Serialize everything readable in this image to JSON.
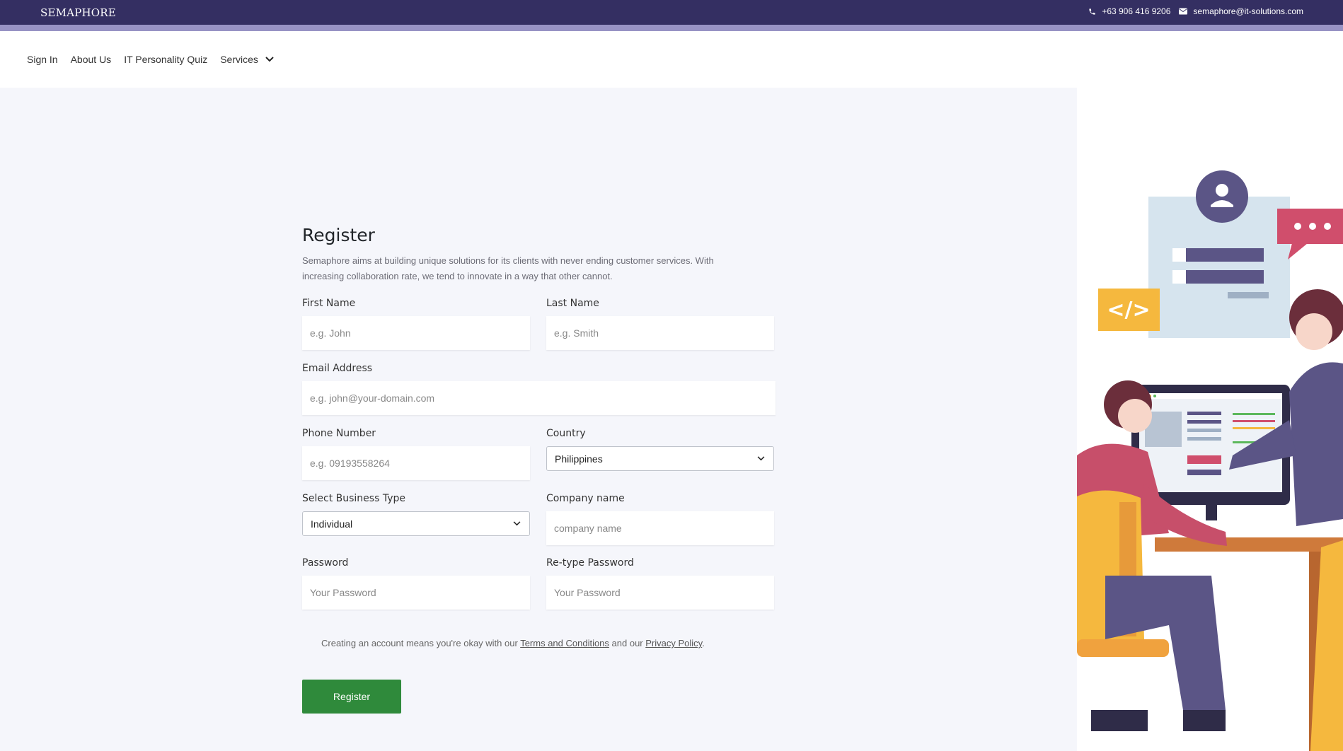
{
  "topbar": {
    "brand": "SEMAPHORE",
    "phone": "+63 906 416 9206",
    "email": "semaphore@it-solutions.com"
  },
  "nav": {
    "sign_in": "Sign In",
    "about_us": "About Us",
    "quiz": "IT Personality Quiz",
    "services": "Services"
  },
  "form": {
    "title": "Register",
    "description": "Semaphore aims at building unique solutions for its clients with never ending customer services. With increasing collaboration rate, we tend to innovate in a way that other cannot.",
    "first_name": {
      "label": "First Name",
      "placeholder": "e.g. John",
      "value": ""
    },
    "last_name": {
      "label": "Last Name",
      "placeholder": "e.g. Smith",
      "value": ""
    },
    "email": {
      "label": "Email Address",
      "placeholder": "e.g. john@your-domain.com",
      "value": ""
    },
    "phone": {
      "label": "Phone Number",
      "placeholder": "e.g. 09193558264",
      "value": ""
    },
    "country": {
      "label": "Country",
      "value": "Philippines"
    },
    "business_type": {
      "label": "Select Business Type",
      "value": "Individual"
    },
    "company": {
      "label": "Company name",
      "placeholder": "company name",
      "value": ""
    },
    "password": {
      "label": "Password",
      "placeholder": "Your Password",
      "value": ""
    },
    "retype_password": {
      "label": "Re-type Password",
      "placeholder": "Your Password",
      "value": ""
    },
    "terms_prefix": "Creating an account means you're okay with our ",
    "terms_link": "Terms and Conditions",
    "terms_middle": " and our ",
    "privacy_link": "Privacy Policy",
    "terms_suffix": ".",
    "submit": "Register"
  },
  "colors": {
    "topbar": "#342f62",
    "stripe": "#9893c4",
    "register_button": "#2f8a3b",
    "page_bg": "#f5f6fb"
  },
  "icons": {
    "phone": "phone-icon",
    "email": "envelope-icon",
    "services_dropdown": "chevron-down-icon",
    "select_dropdown": "chevron-down-icon"
  }
}
